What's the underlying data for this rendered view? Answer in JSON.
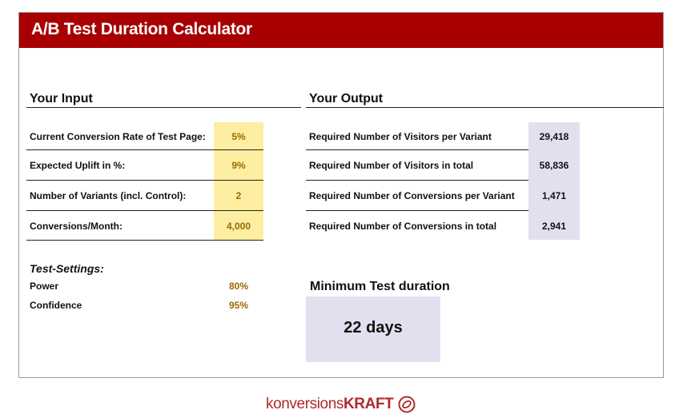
{
  "header": {
    "title": "A/B Test Duration Calculator"
  },
  "input": {
    "title": "Your Input",
    "rows": [
      {
        "label": "Current Conversion Rate of Test Page:",
        "value": "5%"
      },
      {
        "label": "Expected Uplift in %:",
        "value": "9%"
      },
      {
        "label": "Number of Variants (incl. Control):",
        "value": "2"
      },
      {
        "label": "Conversions/Month:",
        "value": "4,000"
      }
    ]
  },
  "output": {
    "title": "Your Output",
    "rows": [
      {
        "label": "Required Number of Visitors per Variant",
        "value": "29,418"
      },
      {
        "label": "Required Number of Visitors in total",
        "value": "58,836"
      },
      {
        "label": "Required Number of Conversions per Variant",
        "value": "1,471"
      },
      {
        "label": "Required Number of Conversions in total",
        "value": "2,941"
      }
    ]
  },
  "settings": {
    "title": "Test-Settings:",
    "power_label": "Power",
    "power_value": "80%",
    "confidence_label": "Confidence",
    "confidence_value": "95%"
  },
  "duration": {
    "title": "Minimum Test duration",
    "value": "22 days"
  },
  "logo": {
    "text_light": "konversions",
    "text_bold": "KRAFT",
    "mark_icon": "konversionskraft-logo-icon"
  },
  "colors": {
    "header": "#a80002",
    "input_highlight": "#fdeea2",
    "output_highlight": "#e2e0ef",
    "accent_value": "#9a6a00",
    "logo": "#b0282b"
  }
}
